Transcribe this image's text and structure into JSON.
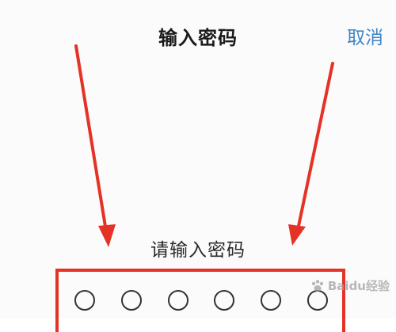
{
  "header": {
    "title": "输入密码",
    "cancel_label": "取消"
  },
  "prompt": {
    "text": "请输入密码"
  },
  "passcode": {
    "digits_shown": 6
  },
  "colors": {
    "accent_blue": "#3f86c6",
    "highlight_red": "#e53227"
  },
  "watermark": {
    "text": "Baidu经验"
  }
}
